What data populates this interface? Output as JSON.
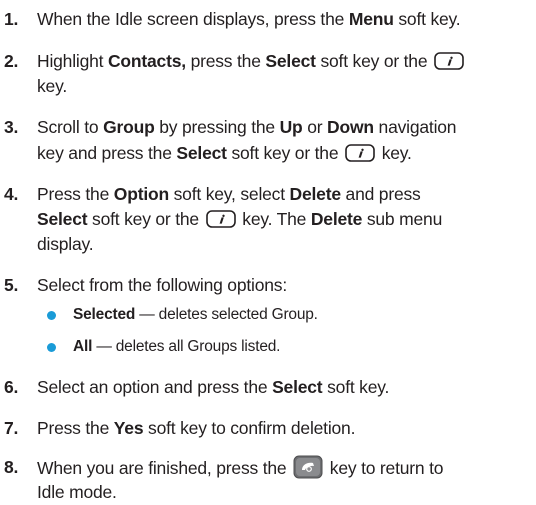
{
  "steps": [
    {
      "num": "1.",
      "l1": [
        "When the Idle screen displays, press the ",
        "Menu",
        " soft key."
      ]
    },
    {
      "num": "2.",
      "l1": [
        "Highlight ",
        "Contacts,",
        " press the ",
        "Select",
        " soft key or the"
      ],
      "l2": "key."
    },
    {
      "num": "3.",
      "l1": [
        "Scroll to ",
        "Group",
        " by pressing the ",
        "Up",
        " or ",
        "Down",
        " navigation"
      ],
      "l2": [
        "key and press the ",
        "Select",
        " soft key or the",
        "key."
      ]
    },
    {
      "num": "4.",
      "l1": [
        "Press the ",
        "Option",
        " soft key, select ",
        "Delete",
        " and press"
      ],
      "l2": [
        "Select",
        " soft key or the",
        "key. The ",
        "Delete",
        " sub menu"
      ],
      "l3": "display."
    },
    {
      "num": "5.",
      "l1": "Select from the following options:"
    },
    {
      "num": "6.",
      "l1": [
        "Select an option and press the ",
        "Select",
        " soft key."
      ]
    },
    {
      "num": "7.",
      "l1": [
        "Press the ",
        "Yes",
        " soft key to confirm deletion."
      ]
    },
    {
      "num": "8.",
      "l1": [
        "When you are finished, press the",
        "key to return to"
      ],
      "l2": "Idle mode."
    }
  ],
  "options": [
    {
      "term": "Selected",
      "desc": " — deletes selected Group."
    },
    {
      "term": "All",
      "desc": " — deletes all Groups listed."
    }
  ],
  "icons": {
    "ok_key": "i-ok-key-icon",
    "end_key": "end-power-key-icon"
  },
  "colors": {
    "bullet": "#1a9bd7",
    "text": "#231f20"
  }
}
